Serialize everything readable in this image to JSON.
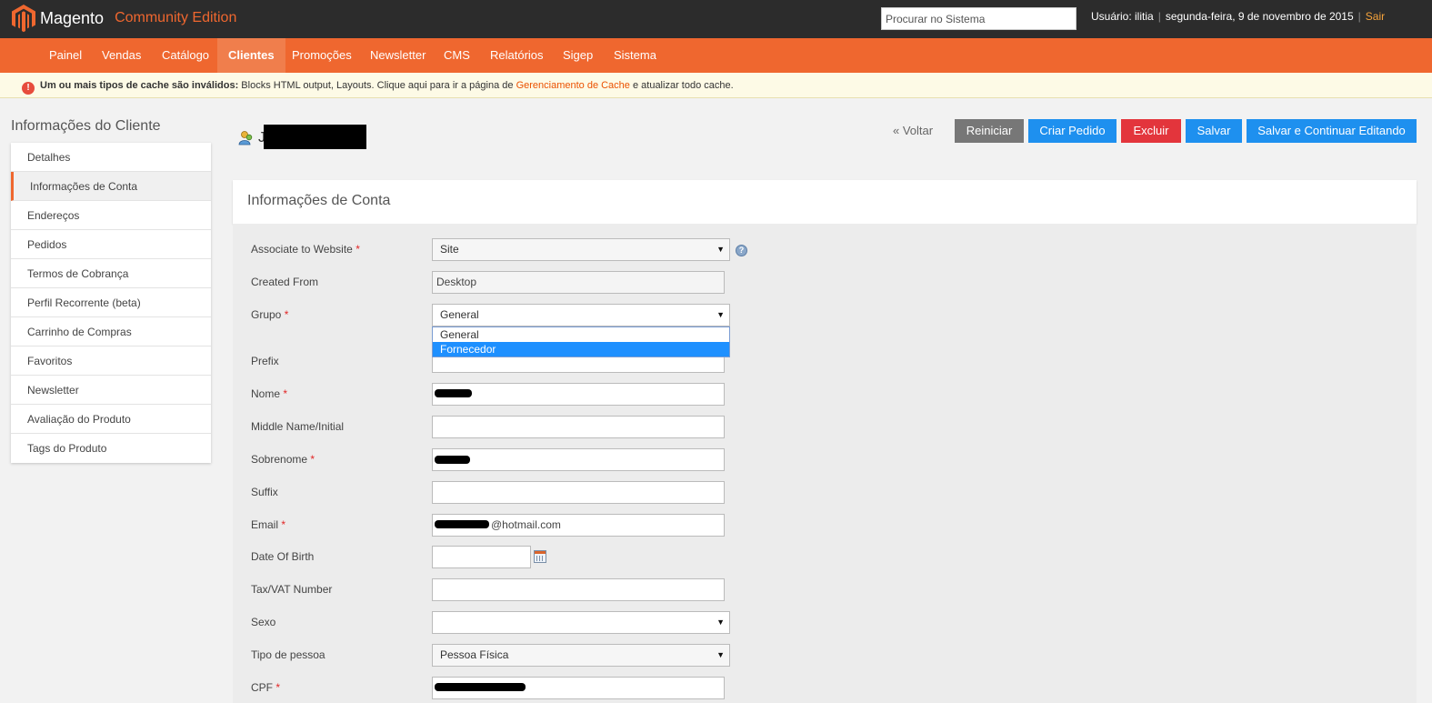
{
  "header": {
    "brand": "Magento",
    "edition": "Community Edition",
    "search_placeholder": "Procurar no Sistema",
    "user": "Usuário: ilitia",
    "date": "segunda-feira, 9 de novembro de 2015",
    "logout": "Sair"
  },
  "nav": {
    "items": [
      "Painel",
      "Vendas",
      "Catálogo",
      "Clientes",
      "Promoções",
      "Newsletter",
      "CMS",
      "Relatórios",
      "Sigep",
      "Sistema"
    ],
    "active": "Clientes"
  },
  "notice": {
    "bold": "Um ou mais tipos de cache são inválidos:",
    "text": " Blocks HTML output, Layouts. Clique aqui para ir a página de ",
    "link": "Gerenciamento de Cache",
    "tail": " e atualizar todo cache."
  },
  "sidebar": {
    "title": "Informações do Cliente",
    "items": [
      "Detalhes",
      "Informações de Conta",
      "Endereços",
      "Pedidos",
      "Termos de Cobrança",
      "Perfil Recorrente (beta)",
      "Carrinho de Compras",
      "Favoritos",
      "Newsletter",
      "Avaliação do Produto",
      "Tags do Produto"
    ],
    "active": "Informações de Conta"
  },
  "page": {
    "customer_initial": "J",
    "back": "« Voltar",
    "reset": "Reiniciar",
    "create_order": "Criar Pedido",
    "delete": "Excluir",
    "save": "Salvar",
    "save_continue": "Salvar e Continuar Editando"
  },
  "section": {
    "title": "Informações de Conta"
  },
  "form": {
    "website_label": "Associate to Website",
    "website_value": "Site",
    "created_from_label": "Created From",
    "created_from_value": "Desktop",
    "group_label": "Grupo",
    "group_value": "General",
    "group_options": [
      "General",
      "Fornecedor"
    ],
    "group_highlighted": "Fornecedor",
    "prefix_label": "Prefix",
    "name_label": "Nome",
    "middle_label": "Middle Name/Initial",
    "lastname_label": "Sobrenome",
    "suffix_label": "Suffix",
    "email_label": "Email",
    "email_value": "@hotmail.com",
    "dob_label": "Date Of Birth",
    "taxvat_label": "Tax/VAT Number",
    "gender_label": "Sexo",
    "gender_value": "",
    "person_type_label": "Tipo de pessoa",
    "person_type_value": "Pessoa Física",
    "cpf_label": "CPF"
  },
  "colors": {
    "header_bg": "#2c2c2c",
    "nav_bg": "#ef672f",
    "accent": "#ef672f",
    "primary_button": "#1e90ef",
    "danger_button": "#e3353c",
    "neutral_button": "#777777"
  }
}
